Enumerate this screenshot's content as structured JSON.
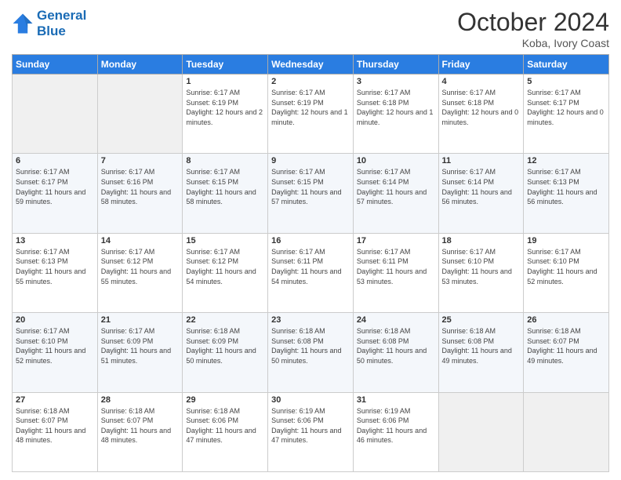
{
  "header": {
    "logo_line1": "General",
    "logo_line2": "Blue",
    "month": "October 2024",
    "location": "Koba, Ivory Coast"
  },
  "weekdays": [
    "Sunday",
    "Monday",
    "Tuesday",
    "Wednesday",
    "Thursday",
    "Friday",
    "Saturday"
  ],
  "weeks": [
    [
      {
        "day": "",
        "info": ""
      },
      {
        "day": "",
        "info": ""
      },
      {
        "day": "1",
        "info": "Sunrise: 6:17 AM\nSunset: 6:19 PM\nDaylight: 12 hours and 2 minutes."
      },
      {
        "day": "2",
        "info": "Sunrise: 6:17 AM\nSunset: 6:19 PM\nDaylight: 12 hours and 1 minute."
      },
      {
        "day": "3",
        "info": "Sunrise: 6:17 AM\nSunset: 6:18 PM\nDaylight: 12 hours and 1 minute."
      },
      {
        "day": "4",
        "info": "Sunrise: 6:17 AM\nSunset: 6:18 PM\nDaylight: 12 hours and 0 minutes."
      },
      {
        "day": "5",
        "info": "Sunrise: 6:17 AM\nSunset: 6:17 PM\nDaylight: 12 hours and 0 minutes."
      }
    ],
    [
      {
        "day": "6",
        "info": "Sunrise: 6:17 AM\nSunset: 6:17 PM\nDaylight: 11 hours and 59 minutes."
      },
      {
        "day": "7",
        "info": "Sunrise: 6:17 AM\nSunset: 6:16 PM\nDaylight: 11 hours and 58 minutes."
      },
      {
        "day": "8",
        "info": "Sunrise: 6:17 AM\nSunset: 6:15 PM\nDaylight: 11 hours and 58 minutes."
      },
      {
        "day": "9",
        "info": "Sunrise: 6:17 AM\nSunset: 6:15 PM\nDaylight: 11 hours and 57 minutes."
      },
      {
        "day": "10",
        "info": "Sunrise: 6:17 AM\nSunset: 6:14 PM\nDaylight: 11 hours and 57 minutes."
      },
      {
        "day": "11",
        "info": "Sunrise: 6:17 AM\nSunset: 6:14 PM\nDaylight: 11 hours and 56 minutes."
      },
      {
        "day": "12",
        "info": "Sunrise: 6:17 AM\nSunset: 6:13 PM\nDaylight: 11 hours and 56 minutes."
      }
    ],
    [
      {
        "day": "13",
        "info": "Sunrise: 6:17 AM\nSunset: 6:13 PM\nDaylight: 11 hours and 55 minutes."
      },
      {
        "day": "14",
        "info": "Sunrise: 6:17 AM\nSunset: 6:12 PM\nDaylight: 11 hours and 55 minutes."
      },
      {
        "day": "15",
        "info": "Sunrise: 6:17 AM\nSunset: 6:12 PM\nDaylight: 11 hours and 54 minutes."
      },
      {
        "day": "16",
        "info": "Sunrise: 6:17 AM\nSunset: 6:11 PM\nDaylight: 11 hours and 54 minutes."
      },
      {
        "day": "17",
        "info": "Sunrise: 6:17 AM\nSunset: 6:11 PM\nDaylight: 11 hours and 53 minutes."
      },
      {
        "day": "18",
        "info": "Sunrise: 6:17 AM\nSunset: 6:10 PM\nDaylight: 11 hours and 53 minutes."
      },
      {
        "day": "19",
        "info": "Sunrise: 6:17 AM\nSunset: 6:10 PM\nDaylight: 11 hours and 52 minutes."
      }
    ],
    [
      {
        "day": "20",
        "info": "Sunrise: 6:17 AM\nSunset: 6:10 PM\nDaylight: 11 hours and 52 minutes."
      },
      {
        "day": "21",
        "info": "Sunrise: 6:17 AM\nSunset: 6:09 PM\nDaylight: 11 hours and 51 minutes."
      },
      {
        "day": "22",
        "info": "Sunrise: 6:18 AM\nSunset: 6:09 PM\nDaylight: 11 hours and 50 minutes."
      },
      {
        "day": "23",
        "info": "Sunrise: 6:18 AM\nSunset: 6:08 PM\nDaylight: 11 hours and 50 minutes."
      },
      {
        "day": "24",
        "info": "Sunrise: 6:18 AM\nSunset: 6:08 PM\nDaylight: 11 hours and 50 minutes."
      },
      {
        "day": "25",
        "info": "Sunrise: 6:18 AM\nSunset: 6:08 PM\nDaylight: 11 hours and 49 minutes."
      },
      {
        "day": "26",
        "info": "Sunrise: 6:18 AM\nSunset: 6:07 PM\nDaylight: 11 hours and 49 minutes."
      }
    ],
    [
      {
        "day": "27",
        "info": "Sunrise: 6:18 AM\nSunset: 6:07 PM\nDaylight: 11 hours and 48 minutes."
      },
      {
        "day": "28",
        "info": "Sunrise: 6:18 AM\nSunset: 6:07 PM\nDaylight: 11 hours and 48 minutes."
      },
      {
        "day": "29",
        "info": "Sunrise: 6:18 AM\nSunset: 6:06 PM\nDaylight: 11 hours and 47 minutes."
      },
      {
        "day": "30",
        "info": "Sunrise: 6:19 AM\nSunset: 6:06 PM\nDaylight: 11 hours and 47 minutes."
      },
      {
        "day": "31",
        "info": "Sunrise: 6:19 AM\nSunset: 6:06 PM\nDaylight: 11 hours and 46 minutes."
      },
      {
        "day": "",
        "info": ""
      },
      {
        "day": "",
        "info": ""
      }
    ]
  ]
}
